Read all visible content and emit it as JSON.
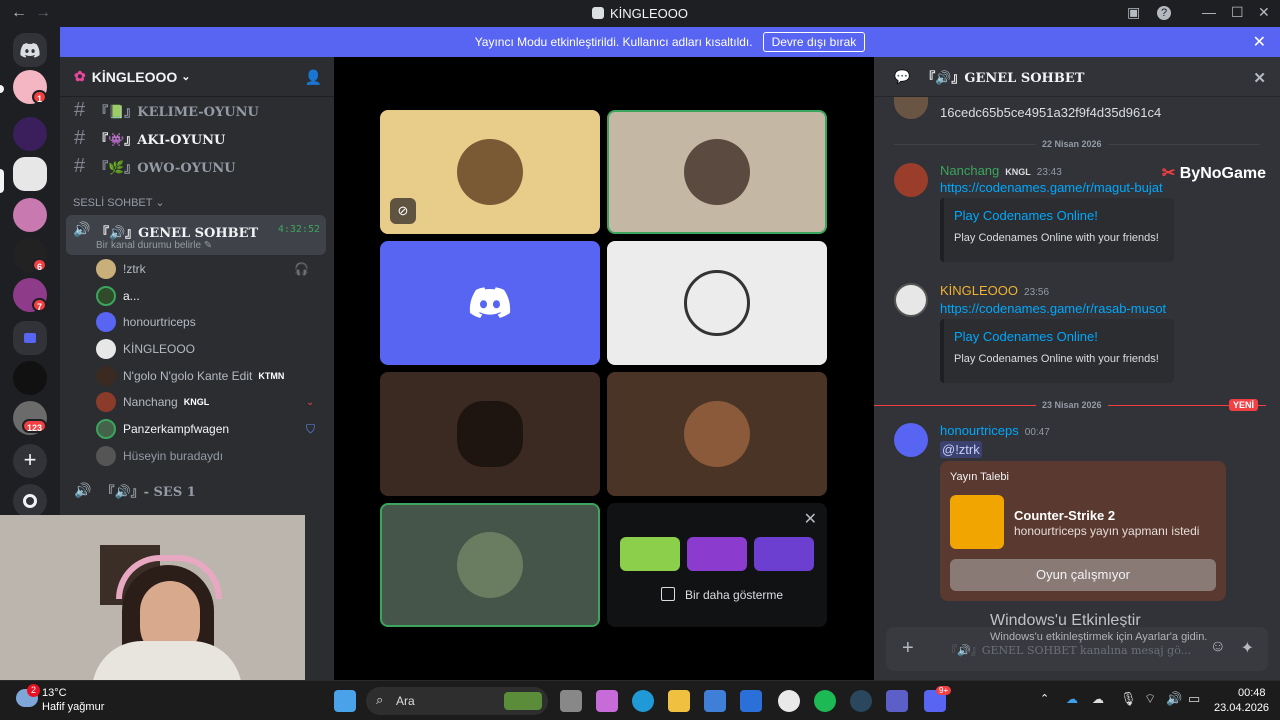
{
  "window": {
    "title": "KİNGLEOOO"
  },
  "banner": {
    "text": "Yayıncı Modu etkinleştirildi. Kullanıcı adları kısaltıldı.",
    "button": "Devre dışı bırak"
  },
  "rail": {
    "badges": [
      "1",
      "6",
      "7",
      "123"
    ]
  },
  "server": {
    "name": "KİNGLEOOO"
  },
  "channels": [
    {
      "name": "『📗』KELIME-OYUNU"
    },
    {
      "name": "『👾』AKI-OYUNU"
    },
    {
      "name": "『🌿』OWO-OYUNU"
    }
  ],
  "voice": {
    "category": "SESLİ SOHBET",
    "channel": "『🔊』GENEL SOHBET",
    "timer": "4:32:52",
    "status": "Bir kanal durumu belirle",
    "users": [
      {
        "name": "!ztrk",
        "tag": ""
      },
      {
        "name": "a...",
        "tag": ""
      },
      {
        "name": "honourtriceps",
        "tag": ""
      },
      {
        "name": "KİNGLEOOO",
        "tag": ""
      },
      {
        "name": "N'golo N'golo Kante Edit",
        "tag": "KTMN"
      },
      {
        "name": "Nanchang",
        "tag": "KNGL"
      },
      {
        "name": "Panzerkampfwagen",
        "tag": ""
      },
      {
        "name": "Hüseyin buradaydı",
        "tag": ""
      }
    ],
    "next_channel": "『🔊』- SES 1"
  },
  "stage": {
    "promo_checkbox": "Bir daha gösterme"
  },
  "chat": {
    "header": "『🔊』GENEL SOHBET",
    "hash_line": "16cedc65b5ce4951a32f9f4d35d961c4",
    "watermark": "ByNoGame",
    "date1": "22 Nisan 2026",
    "date2": "23 Nisan 2026",
    "new_label": "YENİ",
    "messages": [
      {
        "user": "Nanchang",
        "tag": "KNGL",
        "time": "23:43",
        "link": "https://codenames.game/r/magut-bujat",
        "embed_title": "Play Codenames Online!",
        "embed_desc": "Play Codenames Online with your friends!",
        "color": "#3ba55d"
      },
      {
        "user": "KİNGLEOOO",
        "time": "23:56",
        "link": "https://codenames.game/r/rasab-musot",
        "embed_title": "Play Codenames Online!",
        "embed_desc": "Play Codenames Online with your friends!",
        "color": "#f0b232"
      },
      {
        "user": "honourtriceps",
        "time": "00:47",
        "mention": "@!ztrk",
        "color": "#00a8fc"
      }
    ],
    "stream_card": {
      "label": "Yayın Talebi",
      "game": "Counter-Strike 2",
      "sub": "honourtriceps yayın yapmanı istedi",
      "button": "Oyun çalışmıyor"
    },
    "input_placeholder": "『🔊』GENEL SOHBET kanalına mesaj gö...",
    "activation_title": "Windows'u Etkinleştir",
    "activation_sub": "Windows'u etkinleştirmek için Ayarlar'a gidin."
  },
  "taskbar": {
    "weather_temp": "13°C",
    "weather_text": "Hafif yağmur",
    "search": "Ara",
    "time": "00:48",
    "date": "23.04.2026",
    "weather_badge": "2",
    "discord_badge": "9+"
  },
  "colors": {
    "blurple": "#5865f2",
    "green": "#3ba55d",
    "red": "#f23f43"
  }
}
